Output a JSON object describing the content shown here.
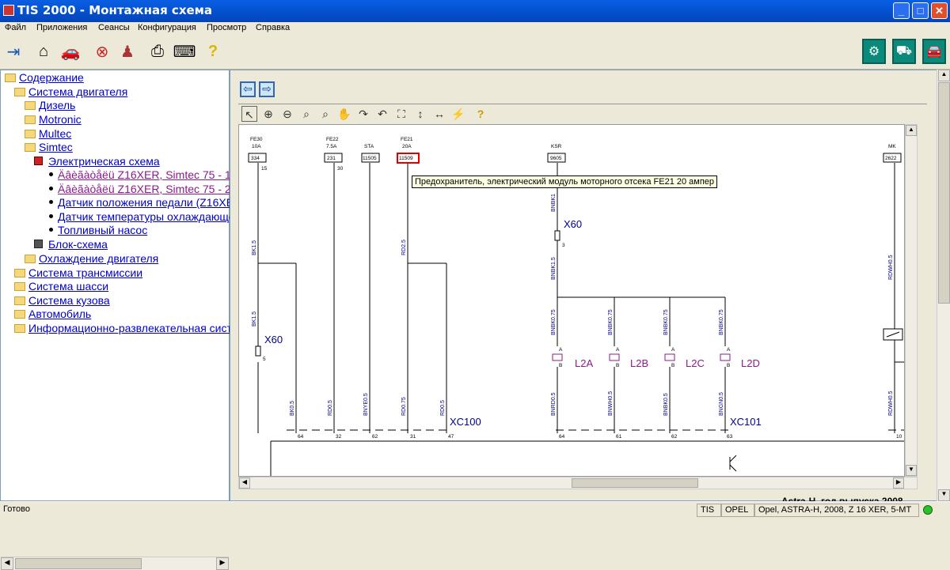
{
  "window": {
    "title": "TIS 2000 - Монтажная схема",
    "min": "_",
    "max": "□",
    "close": "✕"
  },
  "menu": [
    "Файл",
    "Приложения",
    "Сеансы",
    "Конфигурация",
    "Просмотр",
    "Справка"
  ],
  "tree": {
    "root": "Содержание",
    "items": [
      {
        "label": "Система двигателя"
      },
      {
        "label": "Дизель"
      },
      {
        "label": "Motronic"
      },
      {
        "label": "Multec"
      },
      {
        "label": "Simtec"
      },
      {
        "label": "Электрическая схема"
      },
      {
        "label": "Äâèãàòåëü Z16XER, Simtec 75 - 1"
      },
      {
        "label": "Äâèãàòåëü Z16XER, Simtec 75 - 2"
      },
      {
        "label": "Датчик положения педали (Z16XE"
      },
      {
        "label": "Датчик температуры охлаждающе"
      },
      {
        "label": "Топливный насос"
      },
      {
        "label": "Блок-схема"
      },
      {
        "label": "Охлаждение двигателя"
      },
      {
        "label": "Система трансмиссии"
      },
      {
        "label": "Система шасси"
      },
      {
        "label": "Система кузова"
      },
      {
        "label": "Автомобиль"
      },
      {
        "label": "Информационно-развлекательная сист"
      }
    ]
  },
  "schematic": {
    "tooltip": "Предохранитель, электрический модуль моторного отсека FE21 20 ампер",
    "fuses": [
      {
        "name": "FE30",
        "amp": "10A",
        "code": "334",
        "pin": "15"
      },
      {
        "name": "FE22",
        "amp": "7.5A",
        "code": "231",
        "pin": "30"
      },
      {
        "name": "STA",
        "amp": "",
        "code": "11505",
        "pin": ""
      },
      {
        "name": "FE21",
        "amp": "20A",
        "code": "11509",
        "pin": ""
      },
      {
        "name": "KSR",
        "amp": "",
        "code": "9605",
        "pin": ""
      },
      {
        "name": "MK",
        "amp": "",
        "code": "2622",
        "pin": ""
      }
    ],
    "wires": [
      "BK1.5",
      "BK1.5",
      "RD2.5",
      "BNBK1",
      "BNBK1.5",
      "RDWH0.5",
      "BNBK0.75",
      "BNBK0.75",
      "BNBK0.75",
      "BNBK0.75",
      "BK0.5",
      "RD0.5",
      "BNYE0.5",
      "RD0.75",
      "RD0.5",
      "BNRD0.5",
      "BNWH0.5",
      "BNBK0.5",
      "BNGN0.5",
      "RDWH0.5"
    ],
    "connectors": [
      {
        "label": "X60"
      },
      {
        "label": "X60"
      },
      {
        "label": "XC100"
      },
      {
        "label": "XC101"
      }
    ],
    "coils": [
      "L2A",
      "L2B",
      "L2C",
      "L2D"
    ],
    "coil_pins": {
      "a": "A",
      "b": "B"
    },
    "connector_pins": {
      "x60_top": "3",
      "x60_left": "5"
    },
    "xc100_pins": [
      "64",
      "32",
      "62",
      "31",
      "47"
    ],
    "xc101_pins": [
      "64",
      "61",
      "62",
      "63",
      "10"
    ],
    "bottom_cut_text": "Astra-H, год выпуска 2008"
  },
  "status": {
    "text": "Готово",
    "tis": "TIS",
    "brand": "OPEL",
    "vehicle": "Opel, ASTRA-H, 2008, Z 16 XER, 5-MT"
  },
  "colors": {
    "accent": "#0a5ee3",
    "highlight_fuse": "#e00000",
    "coil": "#8b1a8b"
  }
}
